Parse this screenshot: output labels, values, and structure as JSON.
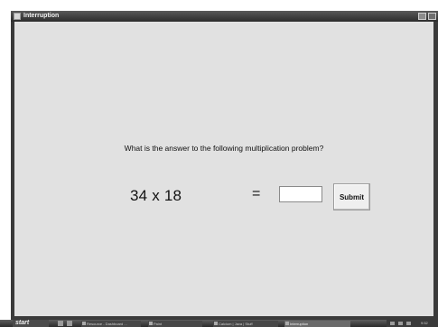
{
  "window": {
    "title": "Interruption"
  },
  "question": "What is the answer to the following multiplication problem?",
  "problem": {
    "expression": "34 x 18",
    "equals": "=",
    "answer_value": "",
    "submit_label": "Submit"
  },
  "taskbar": {
    "start_label": "start",
    "tasks": [
      {
        "label": "Resource - Dashboard ..."
      },
      {
        "label": "Paint"
      },
      {
        "label": "Calcium | Java | Stuff"
      },
      {
        "label": "Interruption"
      }
    ],
    "clock": "9:52"
  }
}
